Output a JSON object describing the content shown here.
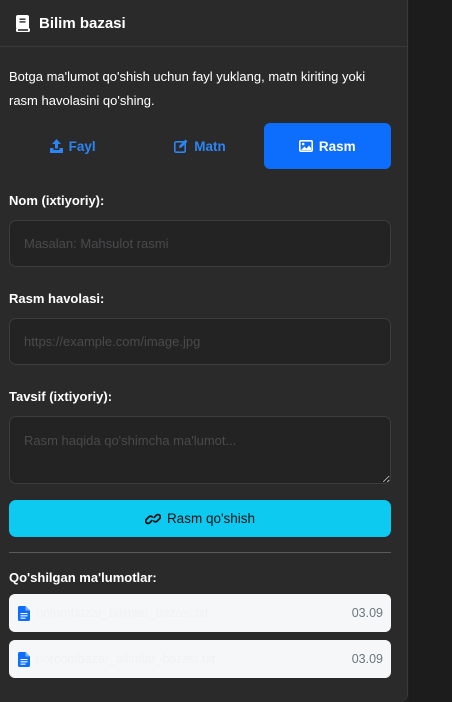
{
  "header": {
    "title": "Bilim bazasi",
    "icon": "book-icon"
  },
  "description": "Botga ma'lumot qo'shish uchun fayl yuklang, matn kiriting yoki rasm havolasini qo'shing.",
  "tabs": [
    {
      "label": "Fayl",
      "icon": "upload-icon",
      "active": false
    },
    {
      "label": "Matn",
      "icon": "edit-icon",
      "active": false
    },
    {
      "label": "Rasm",
      "icon": "image-icon",
      "active": true
    }
  ],
  "form": {
    "name_label": "Nom (ixtiyoriy):",
    "name_placeholder": "Masalan: Mahsulot rasmi",
    "url_label": "Rasm havolasi:",
    "url_placeholder": "https://example.com/image.jpg",
    "desc_label": "Tavsif (ixtiyoriy):",
    "desc_placeholder": "Rasm haqida qo'shimcha ma'lumot...",
    "submit_label": "Rasm qo'shish"
  },
  "added": {
    "title": "Qo'shilgan ma'lumotlar:",
    "items": [
      {
        "name": "optombazar_bilimlar_bazasi.txt",
        "date": "03.09"
      },
      {
        "name": "porcombazar_bilimlar_bazasi.txt",
        "date": "03.09"
      }
    ]
  },
  "colors": {
    "accent": "#0d6efd",
    "tab_text": "#2b85f4",
    "submit": "#0dcaf0",
    "panel": "#2a2a2b"
  }
}
